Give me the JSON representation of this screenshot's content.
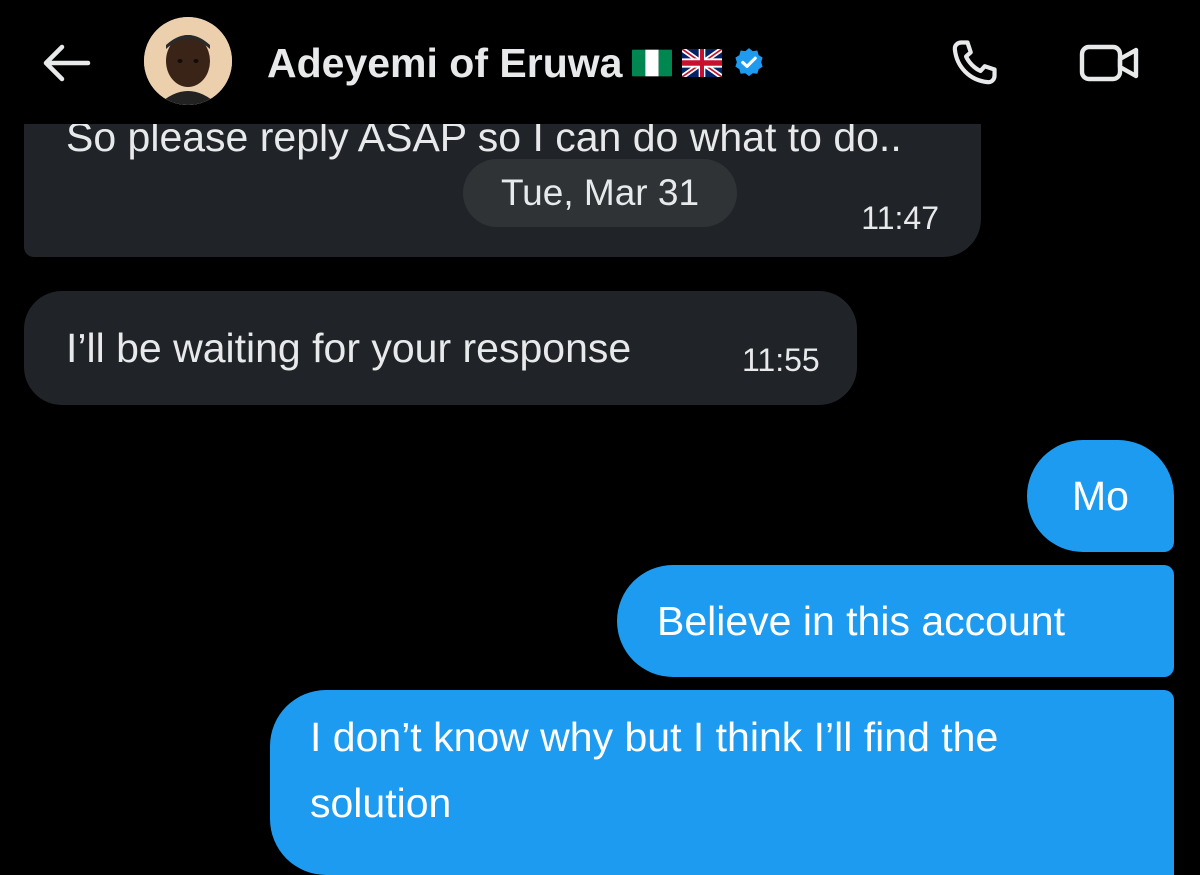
{
  "header": {
    "back_icon": "arrow-left-icon",
    "contact_name": "Adeyemi of Eruwa",
    "flags": [
      "nigeria-flag",
      "uk-flag"
    ],
    "verified_icon": "verified-badge-icon",
    "call_icon": "phone-icon",
    "video_icon": "video-camera-icon"
  },
  "date_separator": "Tue, Mar 31",
  "messages": [
    {
      "direction": "incoming",
      "text": "So please reply ASAP so I can do what to do..",
      "time": "11:47"
    },
    {
      "direction": "incoming",
      "text": "I’ll be waiting for your response",
      "time": "11:55"
    },
    {
      "direction": "outgoing",
      "text": "Mo"
    },
    {
      "direction": "outgoing",
      "text": "Believe in this account"
    },
    {
      "direction": "outgoing",
      "text": "I don’t know why but I think I’ll find the solution"
    }
  ],
  "colors": {
    "background": "#000000",
    "incoming_bubble": "#202327",
    "outgoing_bubble": "#1D9BF0",
    "verified": "#1D9BF0",
    "date_chip": "#2F3336"
  }
}
